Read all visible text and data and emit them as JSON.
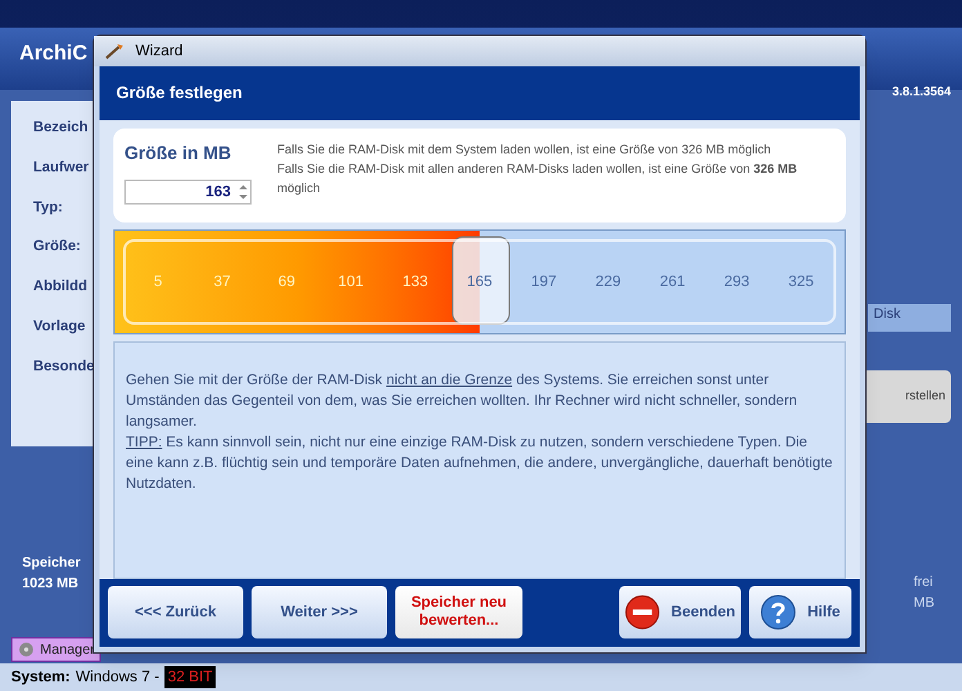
{
  "app": {
    "title": "ArchiC",
    "version": "3.8.1.3564",
    "labels": [
      "Bezeich",
      "Laufwer",
      "Typ:",
      "Größe:",
      "Abbildd",
      "Vorlage",
      "Besonde"
    ],
    "memory_label": "Speicher",
    "memory_value": "1023 MB",
    "right": {
      "disk": "Disk",
      "button": "rstellen",
      "free": "frei",
      "mb": "MB"
    },
    "tab": "Manager",
    "status": {
      "label": "System:",
      "value": "Windows 7 -",
      "badge": "32 BIT"
    }
  },
  "dialog": {
    "title": "Wizard",
    "heading": "Größe festlegen",
    "size_label": "Größe in MB",
    "size_value": "163",
    "info": [
      "Falls Sie die RAM-Disk mit dem System laden wollen, ist eine Größe von 326 MB möglich",
      "Falls Sie die RAM-Disk mit allen anderen RAM-Disks laden wollen, ist eine Größe von  **326 MB** möglich"
    ],
    "scale": {
      "level": 0.5,
      "ticks": [
        "5",
        "37",
        "69",
        "101",
        "133",
        "165",
        "197",
        "229",
        "261",
        "293",
        "325"
      ]
    },
    "hint": [
      [
        {
          "text": "Gehen Sie mit der Größe der RAM-Disk ",
          "underline": false
        },
        {
          "text": "nicht an die Grenze",
          "underline": true
        },
        {
          "text": " des Systems. Sie erreichen sonst unter Umständen das Gegenteil von dem, was Sie erreichen wollten. Ihr Rechner wird nicht schneller, sondern langsamer.",
          "underline": false
        }
      ],
      [
        {
          "text": "TIPP:",
          "underline": true
        },
        {
          "text": " Es kann sinnvoll sein, nicht nur eine einzige RAM-Disk zu nutzen, sondern verschiedene Typen. Die eine kann z.B. flüchtig sein und temporäre Daten aufnehmen, die andere, unvergängliche, dauerhaft benötigte Nutzdaten.",
          "underline": false
        }
      ]
    ],
    "buttons": [
      {
        "kind": "nav",
        "label": "<<< Zurück"
      },
      {
        "kind": "nav",
        "label": "Weiter >>>"
      },
      {
        "kind": "warning",
        "label": "Speicher neu bewerten..."
      },
      {
        "kind": "stop",
        "label": "Beenden"
      },
      {
        "kind": "help",
        "label": "Hilfe"
      }
    ]
  }
}
